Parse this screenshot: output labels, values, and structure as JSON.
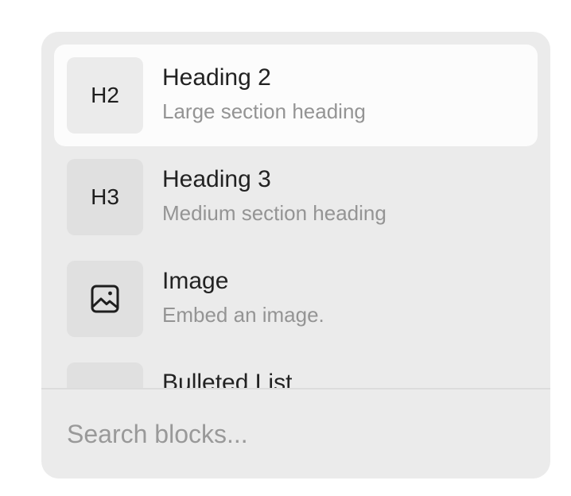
{
  "menu": {
    "items": [
      {
        "icon_text": "H2",
        "title": "Heading 2",
        "description": "Large section heading",
        "selected": true
      },
      {
        "icon_text": "H3",
        "title": "Heading 3",
        "description": "Medium section heading",
        "selected": false
      },
      {
        "icon": "image-icon",
        "title": "Image",
        "description": "Embed an image.",
        "selected": false
      },
      {
        "icon": "bulleted-list-icon",
        "title": "Bulleted List",
        "selected": false
      }
    ]
  },
  "search": {
    "placeholder": "Search blocks...",
    "value": ""
  },
  "colors": {
    "menu_bg": "#ebebeb",
    "selected_bg": "#fcfcfc",
    "icon_box_bg": "#e0e0e0",
    "title": "#222222",
    "description": "#949494"
  }
}
